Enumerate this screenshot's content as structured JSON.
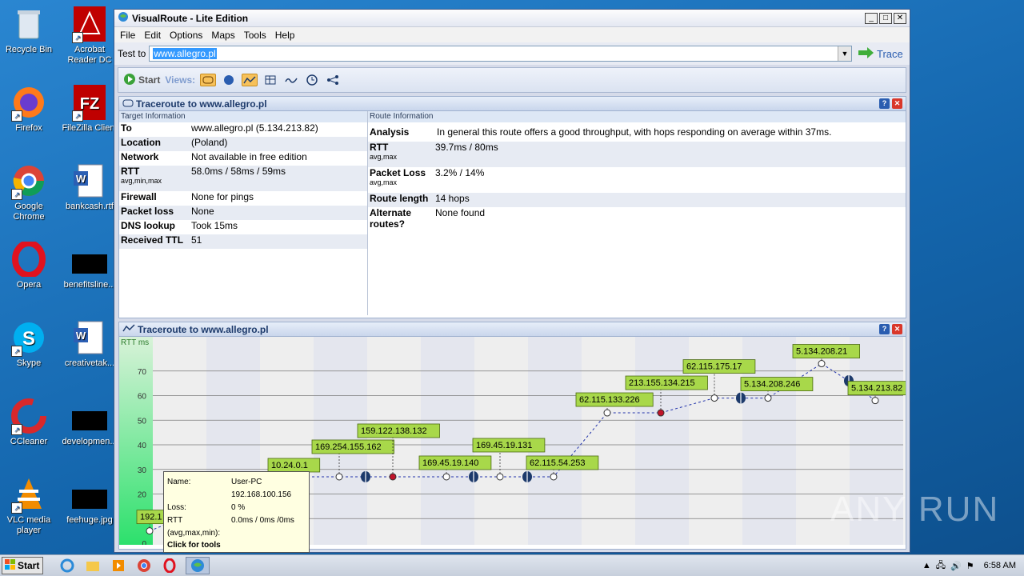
{
  "desktop": {
    "icons": [
      {
        "label": "Recycle Bin"
      },
      {
        "label": "Acrobat Reader DC"
      },
      {
        "label": "Firefox"
      },
      {
        "label": "FileZilla Client"
      },
      {
        "label": "Google Chrome"
      },
      {
        "label": "bankcash.rtf"
      },
      {
        "label": "Opera"
      },
      {
        "label": "benefitsline..."
      },
      {
        "label": "Skype"
      },
      {
        "label": "creativetak..."
      },
      {
        "label": "CCleaner"
      },
      {
        "label": "developmen..."
      },
      {
        "label": "VLC media player"
      },
      {
        "label": "feehuge.jpg"
      }
    ]
  },
  "window": {
    "title": "VisualRoute - Lite Edition",
    "menu": [
      "File",
      "Edit",
      "Options",
      "Maps",
      "Tools",
      "Help"
    ],
    "test_to_label": "Test to",
    "test_to_value": "www.allegro.pl",
    "trace_label": "Trace",
    "toolbar": {
      "start_label": "Start",
      "views_label": "Views:"
    }
  },
  "trace_panel": {
    "title": "Traceroute to www.allegro.pl",
    "target_head": "Target Information",
    "route_head": "Route Information",
    "target": [
      {
        "k": "To",
        "v": "www.allegro.pl (5.134.213.82)",
        "sub": ""
      },
      {
        "k": "Location",
        "v": "(Poland)",
        "sub": ""
      },
      {
        "k": "Network",
        "v": "Not available in free edition",
        "sub": ""
      },
      {
        "k": "RTT",
        "v": "58.0ms / 58ms / 59ms",
        "sub": "avg,min,max"
      },
      {
        "k": "Firewall",
        "v": "None for pings",
        "sub": ""
      },
      {
        "k": "Packet loss",
        "v": "None",
        "sub": ""
      },
      {
        "k": "DNS lookup",
        "v": "Took 15ms",
        "sub": ""
      },
      {
        "k": "Received TTL",
        "v": "51",
        "sub": ""
      }
    ],
    "route": [
      {
        "k": "Analysis",
        "v": "In general this route offers a good throughput, with hops responding on average within 37ms.",
        "sub": ""
      },
      {
        "k": "RTT",
        "v": "39.7ms / 80ms",
        "sub": "avg,max"
      },
      {
        "k": "Packet Loss",
        "v": "3.2% / 14%",
        "sub": "avg,max"
      },
      {
        "k": "Route length",
        "v": "14 hops",
        "sub": ""
      },
      {
        "k": "Alternate routes?",
        "v": "None found",
        "sub": ""
      }
    ]
  },
  "graph_panel": {
    "title": "Traceroute to www.allegro.pl"
  },
  "chart_data": {
    "type": "line",
    "ylabel": "RTT ms",
    "ylim": [
      0,
      80
    ],
    "yticks": [
      0,
      10,
      20,
      30,
      40,
      50,
      60,
      70
    ],
    "hops": [
      {
        "label": "192.1",
        "rtt": 5
      },
      {
        "label": "10.24.0.1",
        "rtt": 27
      },
      {
        "label": "169.254.155.162",
        "rtt": 27
      },
      {
        "label": "",
        "rtt": 27
      },
      {
        "label": "159.122.138.132",
        "rtt": 27
      },
      {
        "label": "169.45.19.140",
        "rtt": 27
      },
      {
        "label": "",
        "rtt": 27
      },
      {
        "label": "169.45.19.131",
        "rtt": 27
      },
      {
        "label": "",
        "rtt": 27
      },
      {
        "label": "62.115.54.253",
        "rtt": 27
      },
      {
        "label": "62.115.133.226",
        "rtt": 53
      },
      {
        "label": "213.155.134.215",
        "rtt": 53
      },
      {
        "label": "62.115.175.17",
        "rtt": 59
      },
      {
        "label": "",
        "rtt": 59
      },
      {
        "label": "5.134.208.246",
        "rtt": 59
      },
      {
        "label": "5.134.208.21",
        "rtt": 73
      },
      {
        "label": "",
        "rtt": 66
      },
      {
        "label": "5.134.213.82",
        "rtt": 58
      }
    ]
  },
  "tooltip": {
    "name_label": "Name:",
    "name_value": "User-PC",
    "ip": "192.168.100.156",
    "loss_label": "Loss:",
    "loss_value": "0 %",
    "rtt_label": "RTT",
    "rtt_value": "0.0ms / 0ms /0ms",
    "rtt_sub": "(avg,max,min):",
    "footer": "Click for tools"
  },
  "taskbar": {
    "start_label": "Start",
    "clock": "6:58 AM"
  },
  "watermark": "ANY RUN"
}
